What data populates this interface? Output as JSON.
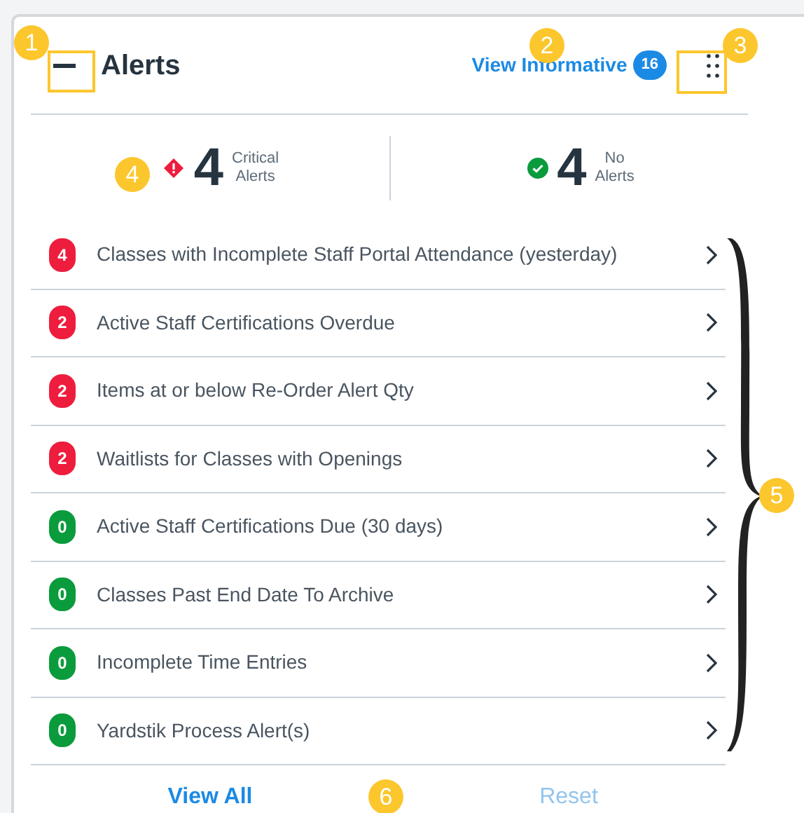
{
  "header": {
    "title": "Alerts",
    "link": "View Informative",
    "link_count": "16"
  },
  "summary": [
    {
      "kind": "critical",
      "count": "4",
      "label_top": "Critical",
      "label_bottom": "Alerts"
    },
    {
      "kind": "ok",
      "count": "4",
      "label_top": "No",
      "label_bottom": "Alerts"
    }
  ],
  "alerts": [
    {
      "count": "4",
      "label": "Classes with Incomplete Staff Portal Attendance (yesterday)",
      "color": "#ee1d3d"
    },
    {
      "count": "2",
      "label": "Active Staff Certifications Overdue",
      "color": "#ee1d3d"
    },
    {
      "count": "2",
      "label": "Items at or below Re-Order Alert Qty",
      "color": "#ee1d3d"
    },
    {
      "count": "2",
      "label": "Waitlists for Classes with Openings",
      "color": "#ee1d3d"
    },
    {
      "count": "0",
      "label": "Active Staff Certifications Due (30 days)",
      "color": "#0a9b3c"
    },
    {
      "count": "0",
      "label": "Classes Past End Date To Archive",
      "color": "#0a9b3c"
    },
    {
      "count": "0",
      "label": "Incomplete Time Entries",
      "color": "#0a9b3c"
    },
    {
      "count": "0",
      "label": "Yardstik Process Alert(s)",
      "color": "#0a9b3c"
    }
  ],
  "footer": [
    {
      "label": "View All",
      "disabled": false
    },
    {
      "label": "Reset",
      "disabled": true
    }
  ],
  "callouts": [
    {
      "label": "1"
    },
    {
      "label": "2"
    },
    {
      "label": "3"
    },
    {
      "label": "4"
    },
    {
      "label": "5"
    },
    {
      "label": "6"
    }
  ]
}
